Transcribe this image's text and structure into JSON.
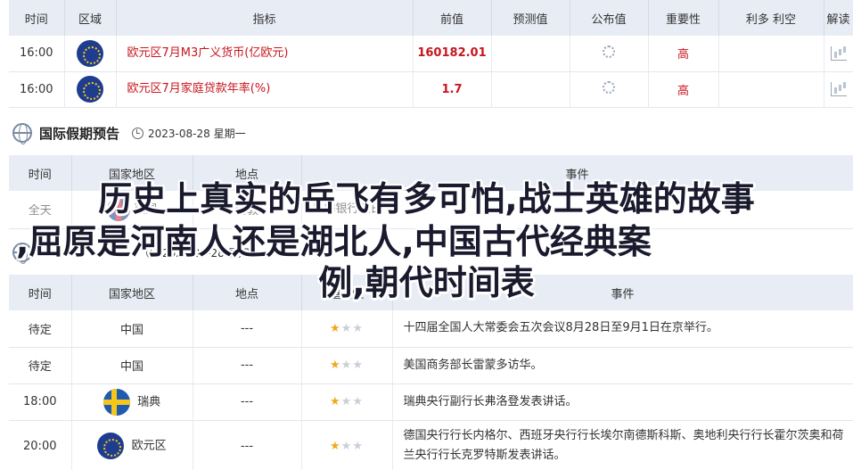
{
  "econ": {
    "headers": [
      "时间",
      "区域",
      "指标",
      "前值",
      "预测值",
      "公布值",
      "重要性",
      "利多 利空",
      "解读"
    ],
    "rows": [
      {
        "time": "16:00",
        "flag": "eu-flag-icon",
        "indicator": "欧元区7月M3广义货币(亿欧元)",
        "prev": "160182.01",
        "importance": "高"
      },
      {
        "time": "16:00",
        "flag": "eu-flag-icon",
        "indicator": "欧元区7月家庭贷款年率(%)",
        "prev": "1.7",
        "importance": "高"
      }
    ]
  },
  "holiday": {
    "title": "国际假期预告",
    "date": "2023-08-28 星期一",
    "headers": [
      "时间",
      "国家地区",
      "地点",
      "事件"
    ],
    "rows": [
      {
        "time": "全天",
        "country": "英国",
        "place": "伦敦",
        "event": "夏季银行假日"
      }
    ]
  },
  "events": {
    "date_partial": "2023-08-28 星期",
    "headers": [
      "时间",
      "国家地区",
      "地点",
      "重要性",
      "事件"
    ],
    "rows": [
      {
        "time": "待定",
        "country": "中国",
        "place": "---",
        "stars": 1,
        "event": "十四届全国人大常委会五次会议8月28日至9月1日在京举行。"
      },
      {
        "time": "待定",
        "country": "中国",
        "place": "---",
        "stars": 1,
        "event": "美国商务部长雷蒙多访华。"
      },
      {
        "time": "18:00",
        "country": "瑞典",
        "flag": "sweden-flag-icon",
        "place": "---",
        "stars": 1,
        "event": "瑞典央行副行长弗洛登发表讲话。"
      },
      {
        "time": "20:00",
        "country": "欧元区",
        "flag": "eu-flag-icon",
        "place": "---",
        "stars": 1,
        "event": "德国央行行长内格尔、西班牙央行行长埃尔南德斯科斯、奥地利央行行长霍尔茨奥和荷兰央行行长克罗特斯发表讲话。"
      }
    ]
  },
  "overlay": {
    "line1": "历史上真实的岳飞有多可怕,战士英雄的故事",
    "line2": ",屈原是河南人还是湖北人,中国古代经典案",
    "line3": "例,朝代时间表"
  }
}
